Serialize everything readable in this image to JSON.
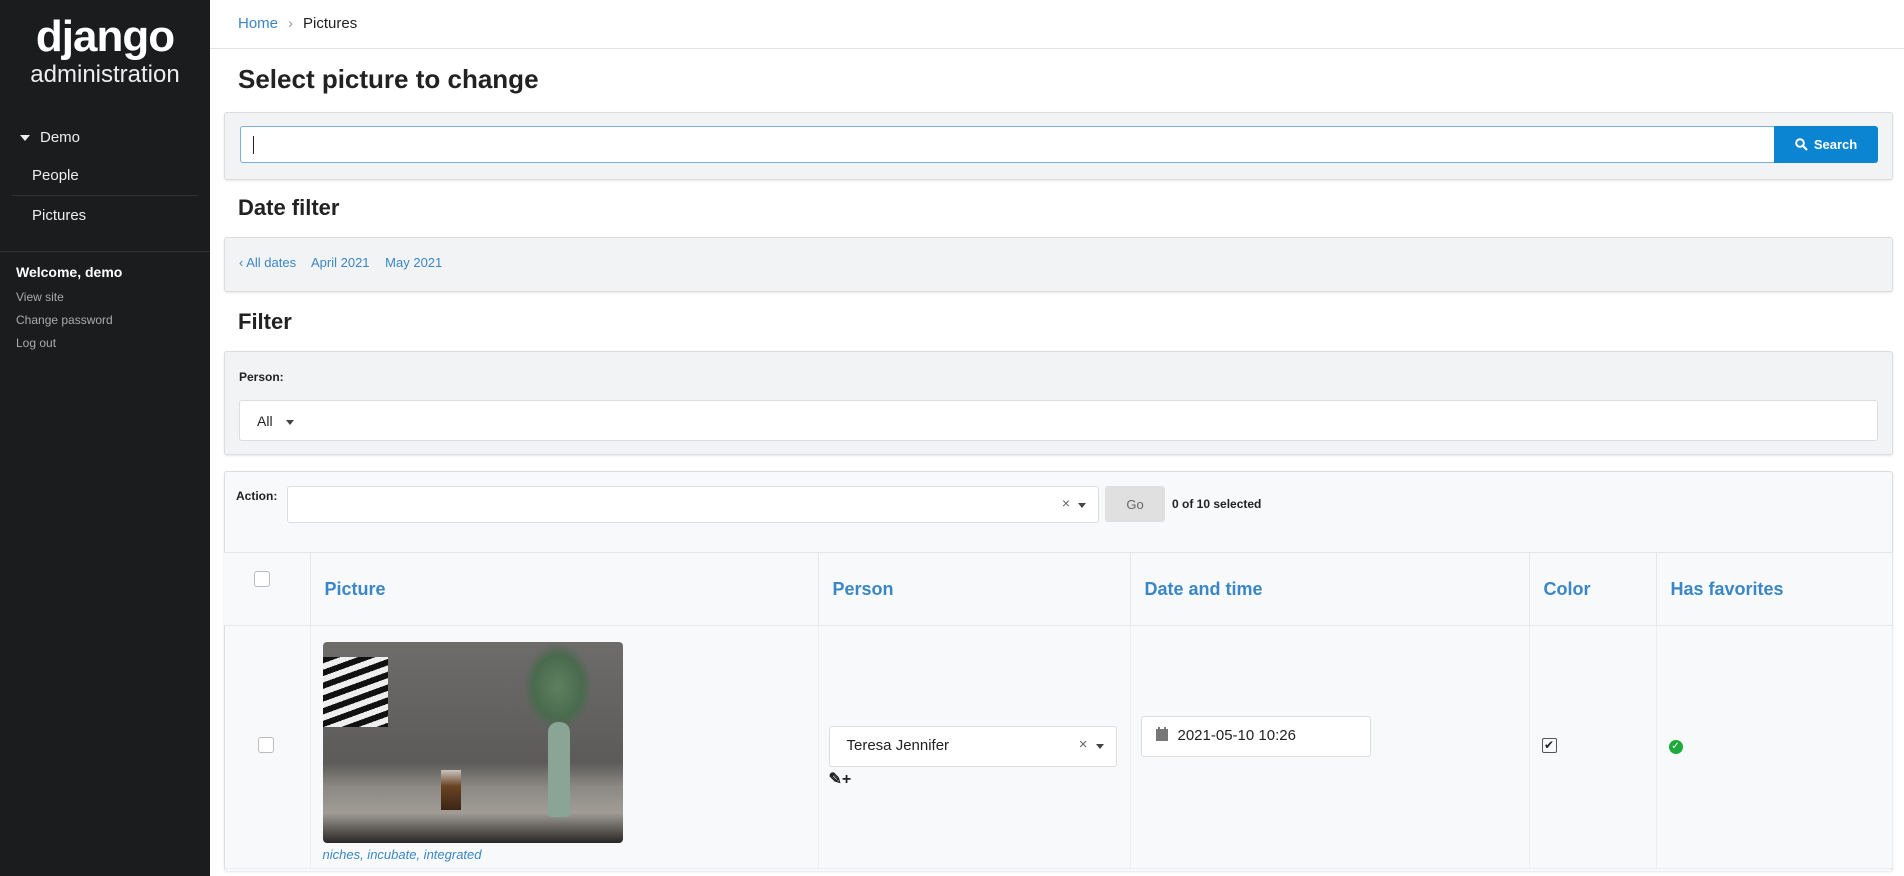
{
  "sidebar": {
    "logo": "django",
    "subtitle": "administration",
    "group": "Demo",
    "items": [
      {
        "label": "People"
      },
      {
        "label": "Pictures"
      }
    ],
    "welcome": "Welcome, demo",
    "links": [
      "View site",
      "Change password",
      "Log out"
    ]
  },
  "breadcrumb": {
    "home": "Home",
    "current": "Pictures"
  },
  "title": "Select picture to change",
  "search": {
    "value": "",
    "button": "Search"
  },
  "date_filter": {
    "heading": "Date filter",
    "links": [
      "‹ All dates",
      "April 2021",
      "May 2021"
    ]
  },
  "filter": {
    "heading": "Filter",
    "label": "Person:",
    "value": "All"
  },
  "actions": {
    "label": "Action:",
    "go": "Go",
    "selected": "0 of 10 selected"
  },
  "table": {
    "columns": [
      "Picture",
      "Person",
      "Date and time",
      "Color",
      "Has favorites"
    ],
    "rows": [
      {
        "caption": "niches, incubate, integrated",
        "person": "Teresa Jennifer",
        "datetime": "2021-05-10 10:26",
        "color": true,
        "has_favorites": true
      }
    ]
  },
  "colors": {
    "accent": "#3a86c6",
    "search_button": "#0b84d2",
    "sidebar": "#1b1c1e",
    "success": "#1fab3c"
  }
}
